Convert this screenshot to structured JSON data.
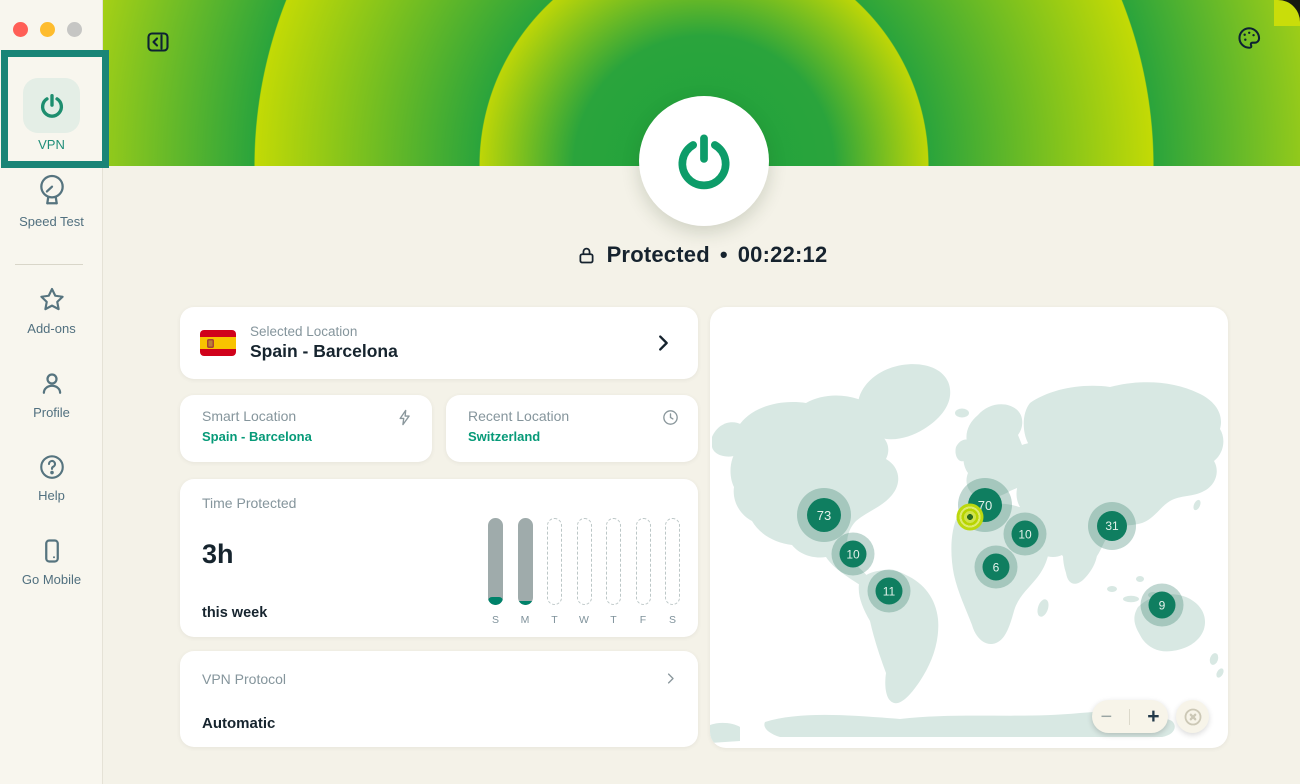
{
  "meta": {
    "accent_green": "#2aa43c",
    "accent_lime": "#c3da05",
    "accent_teal": "#0f9c6d",
    "highlight_box_color": "#1a8577"
  },
  "sidebar": {
    "items": [
      {
        "label": "VPN",
        "active": true
      },
      {
        "label": "Speed Test",
        "active": false
      },
      {
        "label": "Add-ons",
        "active": false
      },
      {
        "label": "Profile",
        "active": false
      },
      {
        "label": "Help",
        "active": false
      },
      {
        "label": "Go Mobile",
        "active": false
      }
    ]
  },
  "header": {
    "status": "Protected",
    "separator": "•",
    "session_time": "00:22:12"
  },
  "cards": {
    "selected_location": {
      "label": "Selected Location",
      "value": "Spain - Barcelona",
      "flag": "spain-flag"
    },
    "smart_location": {
      "label": "Smart Location",
      "value": "Spain - Barcelona"
    },
    "recent_location": {
      "label": "Recent Location",
      "value": "Switzerland"
    },
    "time_protected": {
      "label": "Time Protected",
      "value": "3h",
      "subtitle": "this week",
      "days": [
        "S",
        "M",
        "T",
        "W",
        "T",
        "F",
        "S"
      ],
      "filled_days": [
        "S",
        "M"
      ]
    },
    "vpn_protocol": {
      "label": "VPN Protocol",
      "value": "Automatic"
    }
  },
  "map": {
    "clusters": [
      {
        "count": "73"
      },
      {
        "count": "10"
      },
      {
        "count": "11"
      },
      {
        "count": "70"
      },
      {
        "count": "10"
      },
      {
        "count": "6"
      },
      {
        "count": "31"
      },
      {
        "count": "9"
      }
    ],
    "current_location_marker": "connected-location",
    "zoom_out_label": "−",
    "zoom_in_label": "+"
  }
}
